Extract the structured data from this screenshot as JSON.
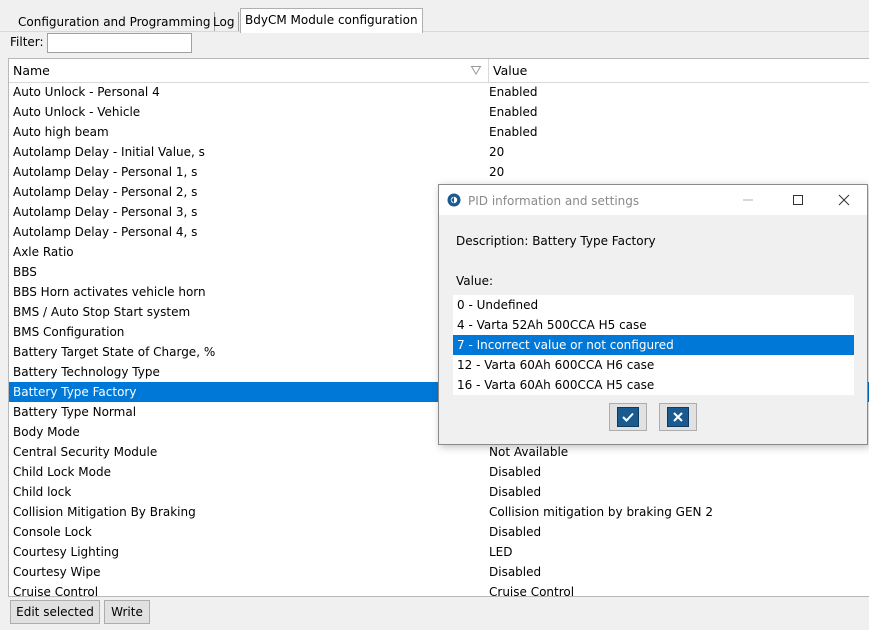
{
  "tabs": [
    {
      "label": "Configuration and Programming"
    },
    {
      "label": "Log"
    },
    {
      "label": "BdyCM Module configuration"
    }
  ],
  "filter": {
    "label": "Filter:",
    "value": ""
  },
  "table": {
    "columns": {
      "name": "Name",
      "value": "Value"
    },
    "rows": [
      {
        "name": "Auto Unlock - Personal 4",
        "value": "Enabled"
      },
      {
        "name": "Auto Unlock - Vehicle",
        "value": "Enabled"
      },
      {
        "name": "Auto high beam",
        "value": "Enabled"
      },
      {
        "name": "Autolamp Delay - Initial Value, s",
        "value": "20"
      },
      {
        "name": "Autolamp Delay - Personal 1, s",
        "value": "20"
      },
      {
        "name": "Autolamp Delay - Personal 2, s",
        "value": ""
      },
      {
        "name": "Autolamp Delay - Personal 3, s",
        "value": ""
      },
      {
        "name": "Autolamp Delay - Personal 4, s",
        "value": ""
      },
      {
        "name": "Axle Ratio",
        "value": ""
      },
      {
        "name": "BBS",
        "value": ""
      },
      {
        "name": "BBS Horn activates vehicle horn",
        "value": ""
      },
      {
        "name": "BMS / Auto Stop Start system",
        "value": ""
      },
      {
        "name": "BMS Configuration",
        "value": ""
      },
      {
        "name": "Battery Target State of Charge, %",
        "value": ""
      },
      {
        "name": "Battery Technology Type",
        "value": ""
      },
      {
        "name": "Battery Type Factory",
        "value": "",
        "selected": true
      },
      {
        "name": "Battery Type Normal",
        "value": ""
      },
      {
        "name": "Body Mode",
        "value": ""
      },
      {
        "name": "Central Security Module",
        "value": "Not Available"
      },
      {
        "name": "Child Lock Mode",
        "value": "Disabled"
      },
      {
        "name": "Child lock",
        "value": "Disabled"
      },
      {
        "name": "Collision Mitigation By Braking",
        "value": "Collision mitigation by braking GEN 2"
      },
      {
        "name": "Console Lock",
        "value": "Disabled"
      },
      {
        "name": "Courtesy Lighting",
        "value": "LED"
      },
      {
        "name": "Courtesy Wipe",
        "value": "Disabled"
      },
      {
        "name": "Cruise Control",
        "value": "Cruise Control"
      }
    ]
  },
  "buttons": {
    "edit_selected": "Edit selected",
    "write": "Write"
  },
  "dialog": {
    "title": "PID information and settings",
    "description": "Description: Battery Type Factory",
    "value_label": "Value:",
    "options": [
      {
        "label": "0 - Undefined"
      },
      {
        "label": "4 - Varta 52Ah 500CCA H5 case"
      },
      {
        "label": "7 - Incorrect value or not configured",
        "selected": true
      },
      {
        "label": "12 - Varta 60Ah 600CCA H6 case"
      },
      {
        "label": "16 - Varta 60Ah 600CCA H5 case"
      }
    ],
    "ok_icon": "checkmark-icon",
    "cancel_icon": "x-icon"
  },
  "colors": {
    "selection": "#0078d7",
    "icon_button": "#1b5a8f"
  }
}
